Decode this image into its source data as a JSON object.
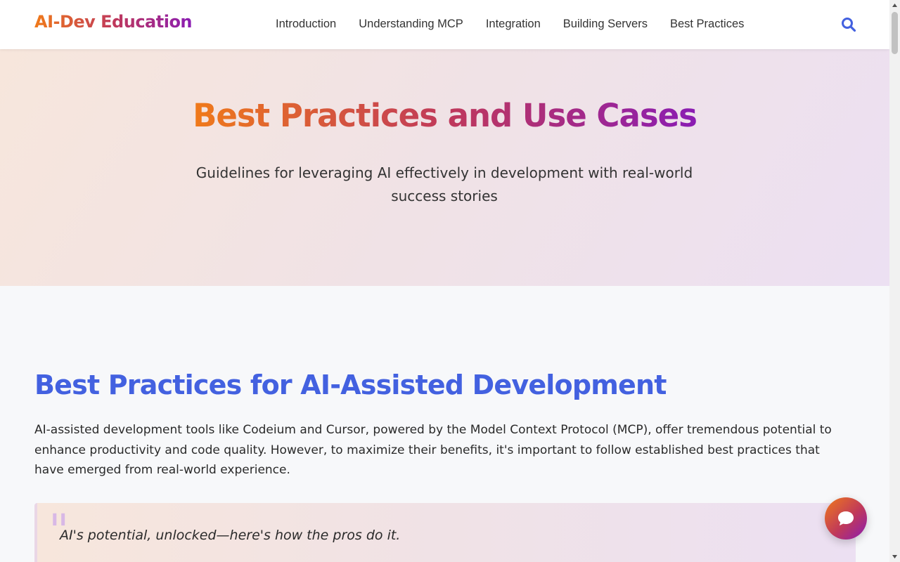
{
  "header": {
    "logo": "AI-Dev Education",
    "nav": [
      {
        "label": "Introduction"
      },
      {
        "label": "Understanding MCP"
      },
      {
        "label": "Integration"
      },
      {
        "label": "Building Servers"
      },
      {
        "label": "Best Practices"
      }
    ],
    "search_icon": "search-icon"
  },
  "hero": {
    "title": "Best Practices and Use Cases",
    "subtitle": "Guidelines for leveraging AI effectively in development with real-world success stories"
  },
  "content": {
    "section_title": "Best Practices for AI-Assisted Development",
    "section_body": "AI-assisted development tools like Codeium and Cursor, powered by the Model Context Protocol (MCP), offer tremendous potential to enhance productivity and code quality. However, to maximize their benefits, it's important to follow established best practices that have emerged from real-world experience.",
    "quote": "AI's potential, unlocked—here's how the pros do it."
  },
  "chat": {
    "icon": "chat-bubble-icon"
  },
  "colors": {
    "accent_blue": "#4361e0",
    "gradient_start": "#f07a1a",
    "gradient_mid": "#c0395a",
    "gradient_end": "#8a1cb3"
  }
}
